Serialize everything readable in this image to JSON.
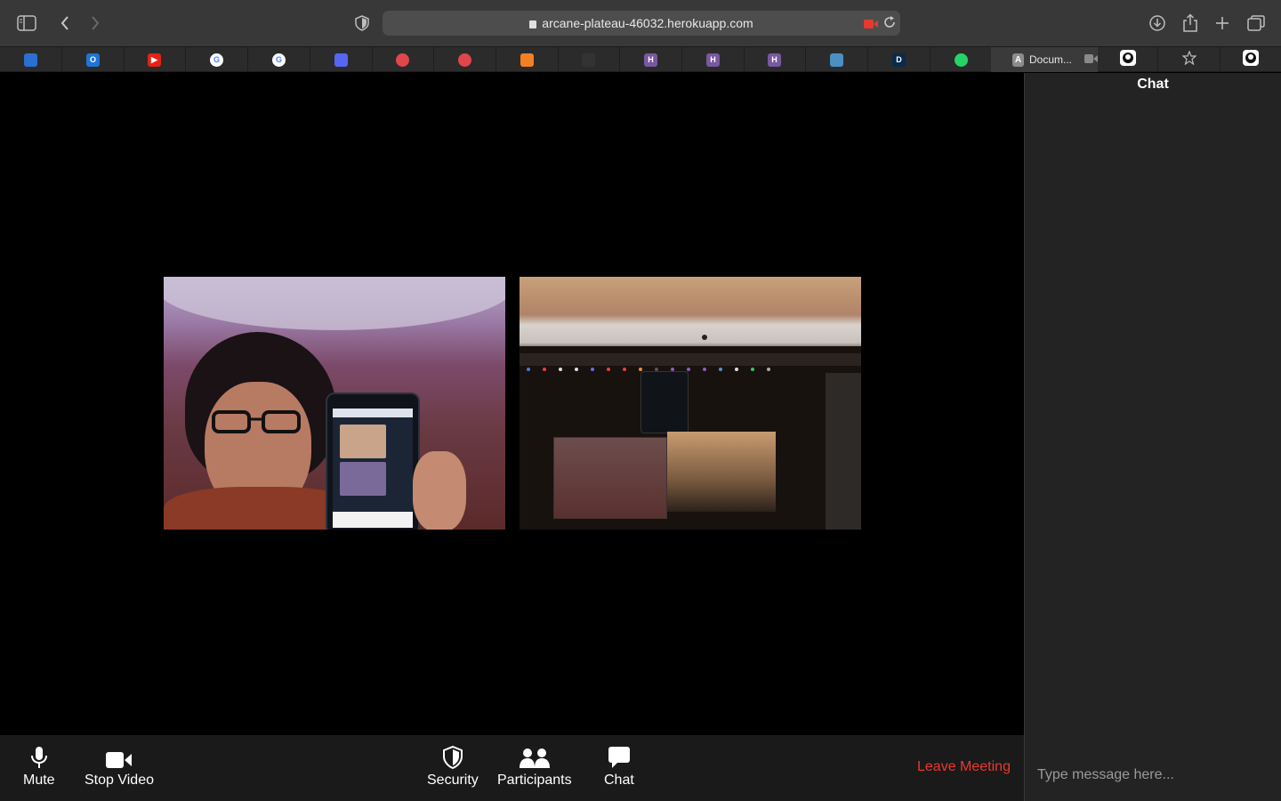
{
  "browser": {
    "url": "arcane-plateau-46032.herokuapp.com",
    "icons": [
      "sidebar-icon",
      "back-icon",
      "forward-icon",
      "shield-icon",
      "lock-icon",
      "camera-recording-icon",
      "reload-icon",
      "download-icon",
      "share-icon",
      "new-tab-icon",
      "tab-overview-icon"
    ]
  },
  "favorites": [
    {
      "name": "fav-1",
      "letter": "",
      "color": "#2b6fd1"
    },
    {
      "name": "fav-outlook",
      "letter": "O",
      "color": "#1f74d4"
    },
    {
      "name": "fav-youtube",
      "letter": "▶",
      "color": "#e62117"
    },
    {
      "name": "fav-google-1",
      "letter": "G",
      "color": "#ffffff"
    },
    {
      "name": "fav-google-2",
      "letter": "G",
      "color": "#ffffff"
    },
    {
      "name": "fav-discord",
      "letter": "",
      "color": "#5865f2"
    },
    {
      "name": "fav-red-1",
      "letter": "",
      "color": "#e0464b"
    },
    {
      "name": "fav-red-2",
      "letter": "",
      "color": "#e0464b"
    },
    {
      "name": "fav-stackoverflow",
      "letter": "",
      "color": "#f48024"
    },
    {
      "name": "fav-dark",
      "letter": "",
      "color": "#333333"
    },
    {
      "name": "fav-heroku-1",
      "letter": "H",
      "color": "#79589f"
    },
    {
      "name": "fav-heroku-2",
      "letter": "H",
      "color": "#79589f"
    },
    {
      "name": "fav-heroku-3",
      "letter": "H",
      "color": "#79589f"
    },
    {
      "name": "fav-cloud",
      "letter": "",
      "color": "#4a90c2"
    },
    {
      "name": "fav-d",
      "letter": "D",
      "color": "#0b2a4a"
    },
    {
      "name": "fav-whatsapp",
      "letter": "",
      "color": "#25d366"
    }
  ],
  "active_tab": {
    "favicon_letter": "A",
    "title": "Docum..."
  },
  "right_tabs": [
    "github-icon",
    "star-icon",
    "github-icon"
  ],
  "controls": {
    "mute": "Mute",
    "stop_video": "Stop Video",
    "security": "Security",
    "participants": "Participants",
    "chat": "Chat",
    "leave": "Leave Meeting"
  },
  "chat": {
    "title": "Chat",
    "placeholder": "Type message here..."
  },
  "colors": {
    "leave": "#e8392f",
    "toolbar": "#383838",
    "control_bar": "#1a1a1a"
  }
}
